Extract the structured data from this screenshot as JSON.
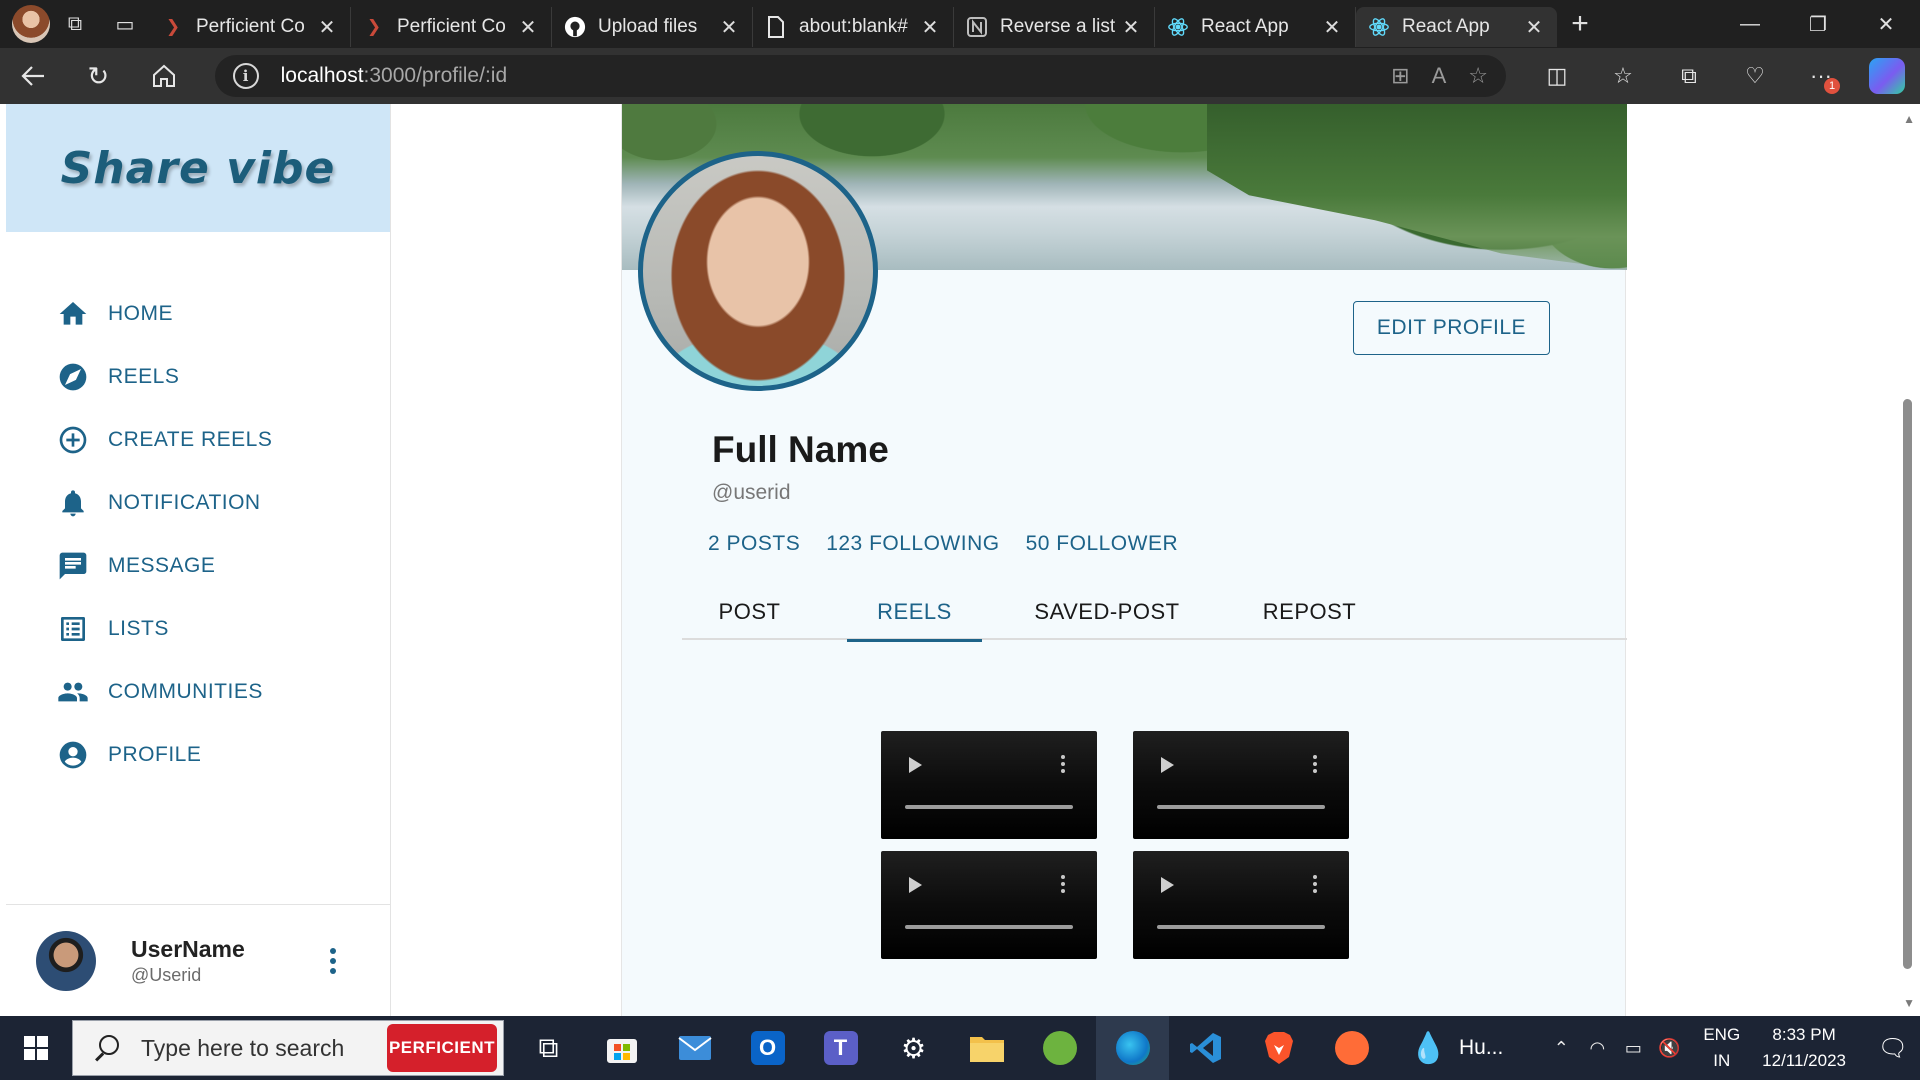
{
  "browser": {
    "tabs": [
      {
        "title": "Perficient Co",
        "icon": "perficient-icon",
        "active": false
      },
      {
        "title": "Perficient Co",
        "icon": "perficient-icon",
        "active": false
      },
      {
        "title": "Upload files",
        "icon": "github-icon",
        "active": false
      },
      {
        "title": "about:blank#",
        "icon": "page-icon",
        "active": false
      },
      {
        "title": "Reverse a list",
        "icon": "notion-icon",
        "active": false
      },
      {
        "title": "React App",
        "icon": "react-icon",
        "active": false
      },
      {
        "title": "React App",
        "icon": "react-icon",
        "active": true
      }
    ],
    "url_host": "localhost",
    "url_path": ":3000/profile/:id",
    "notification_badge": "1"
  },
  "sidebar": {
    "brand": "Share vibe",
    "items": [
      {
        "label": "HOME",
        "icon": "home-icon"
      },
      {
        "label": "REELS",
        "icon": "explore-icon"
      },
      {
        "label": "CREATE REELS",
        "icon": "add-circle-icon"
      },
      {
        "label": "NOTIFICATION",
        "icon": "bell-icon"
      },
      {
        "label": "MESSAGE",
        "icon": "message-icon"
      },
      {
        "label": "LISTS",
        "icon": "list-icon"
      },
      {
        "label": "COMMUNITIES",
        "icon": "people-icon"
      },
      {
        "label": "PROFILE",
        "icon": "account-icon"
      }
    ],
    "user": {
      "name": "UserName",
      "id": "@Userid"
    }
  },
  "profile": {
    "edit_label": "EDIT PROFILE",
    "full_name": "Full Name",
    "handle": "@userid",
    "stats": [
      "2 POSTS",
      "123 FOLLOWING",
      "50 FOLLOWER"
    ],
    "tabs": [
      "POST",
      "REELS",
      "SAVED-POST",
      "REPOST"
    ],
    "active_tab": "REELS",
    "accent_color": "#1d6389"
  },
  "taskbar": {
    "search_placeholder": "Type here to search",
    "search_badge": "PERFICIENT",
    "weather": "Hu...",
    "language": "ENG",
    "region": "IN",
    "time": "8:33 PM",
    "date": "12/11/2023"
  }
}
